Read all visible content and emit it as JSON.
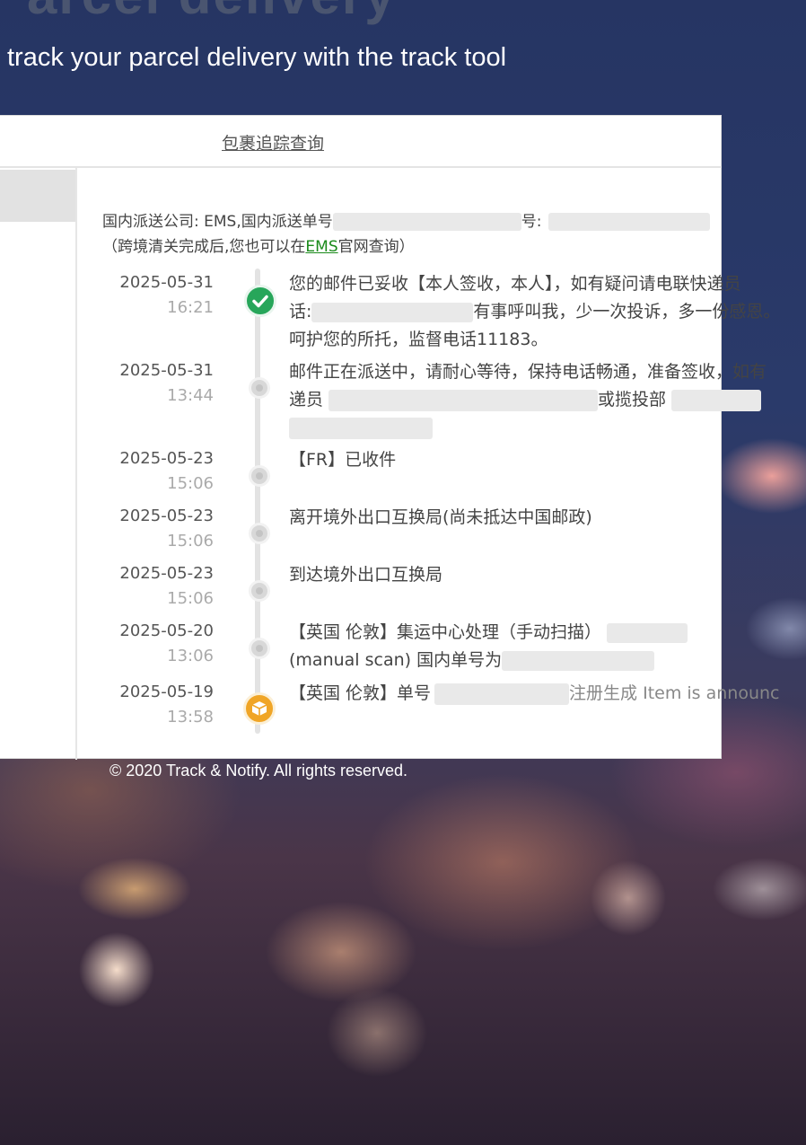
{
  "hero": {
    "title_fragment": "arcel delivery",
    "subtitle": "track your parcel delivery with the track tool"
  },
  "card": {
    "tab_label": "包裹追踪查询",
    "info_line1_prefix": "国内派送公司: EMS,国内派送单号",
    "info_line1_mid": "号:",
    "info_line2_prefix": "（跨境清关完成后,您也可以在",
    "info_line2_link": "EMS",
    "info_line2_suffix": "官网查询）"
  },
  "events": [
    {
      "date": "2025-05-31",
      "time": "16:21",
      "line1": "您的邮件已妥收【本人签收，本人】，如有疑问请电联快递员",
      "line2_prefix": "话:",
      "line2_suffix": "有事呼叫我，少一次投诉，多一份感恩。",
      "line3": "呵护您的所托，监督电话11183。"
    },
    {
      "date": "2025-05-31",
      "time": "13:44",
      "line1": "邮件正在派送中，请耐心等待，保持电话畅通，准备签收，如有",
      "line2_prefix": "递员",
      "line2_suffix": "或揽投部"
    },
    {
      "date": "2025-05-23",
      "time": "15:06",
      "line1": "【FR】已收件"
    },
    {
      "date": "2025-05-23",
      "time": "15:06",
      "line1": "离开境外出口互换局(尚未抵达中国邮政)"
    },
    {
      "date": "2025-05-23",
      "time": "15:06",
      "line1": "到达境外出口互换局"
    },
    {
      "date": "2025-05-20",
      "time": "13:06",
      "line1": "【英国 伦敦】集运中心处理（手动扫描）",
      "line2_prefix": "(manual scan) 国内单号为"
    },
    {
      "date": "2025-05-19",
      "time": "13:58",
      "line1_prefix": "【英国 伦敦】单号",
      "line1_suffix": "注册生成 Item is announc"
    }
  ],
  "footer": {
    "text": "© 2020 Track & Notify. All rights reserved."
  },
  "colors": {
    "success": "#27a65a",
    "package": "#f0a526",
    "link": "#1a8a1a"
  },
  "icons": [
    "check-icon",
    "package-icon"
  ]
}
